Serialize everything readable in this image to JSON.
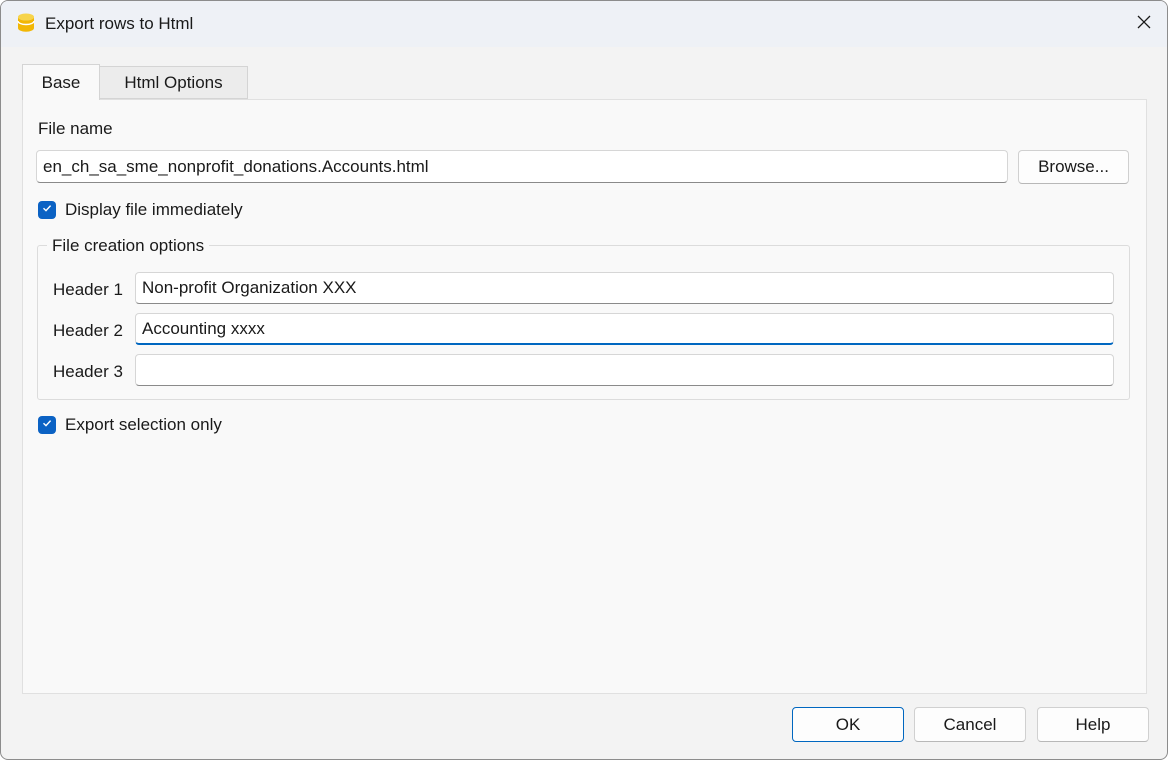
{
  "window": {
    "title": "Export rows to Html",
    "app_icon": "banana-app-icon",
    "close_icon": "close-icon"
  },
  "tabs": [
    {
      "label": "Base",
      "selected": true
    },
    {
      "label": "Html Options",
      "selected": false
    }
  ],
  "base": {
    "file_name_label": "File name",
    "file_name_value": "en_ch_sa_sme_nonprofit_donations.Accounts.html",
    "browse_label": "Browse...",
    "display_immediately": {
      "label": "Display file immediately",
      "checked": true
    },
    "file_creation_group": {
      "title": "File creation options",
      "headers": [
        {
          "label": "Header 1",
          "value": "Non-profit Organization XXX"
        },
        {
          "label": "Header 2",
          "value": "Accounting xxxx"
        },
        {
          "label": "Header 3",
          "value": ""
        }
      ]
    },
    "export_selection_only": {
      "label": "Export selection only",
      "checked": true
    }
  },
  "footer": {
    "ok_label": "OK",
    "cancel_label": "Cancel",
    "help_label": "Help"
  },
  "colors": {
    "accent": "#0067c0",
    "checkbox": "#0b62c4",
    "icon_yellow": "#f5c400"
  }
}
